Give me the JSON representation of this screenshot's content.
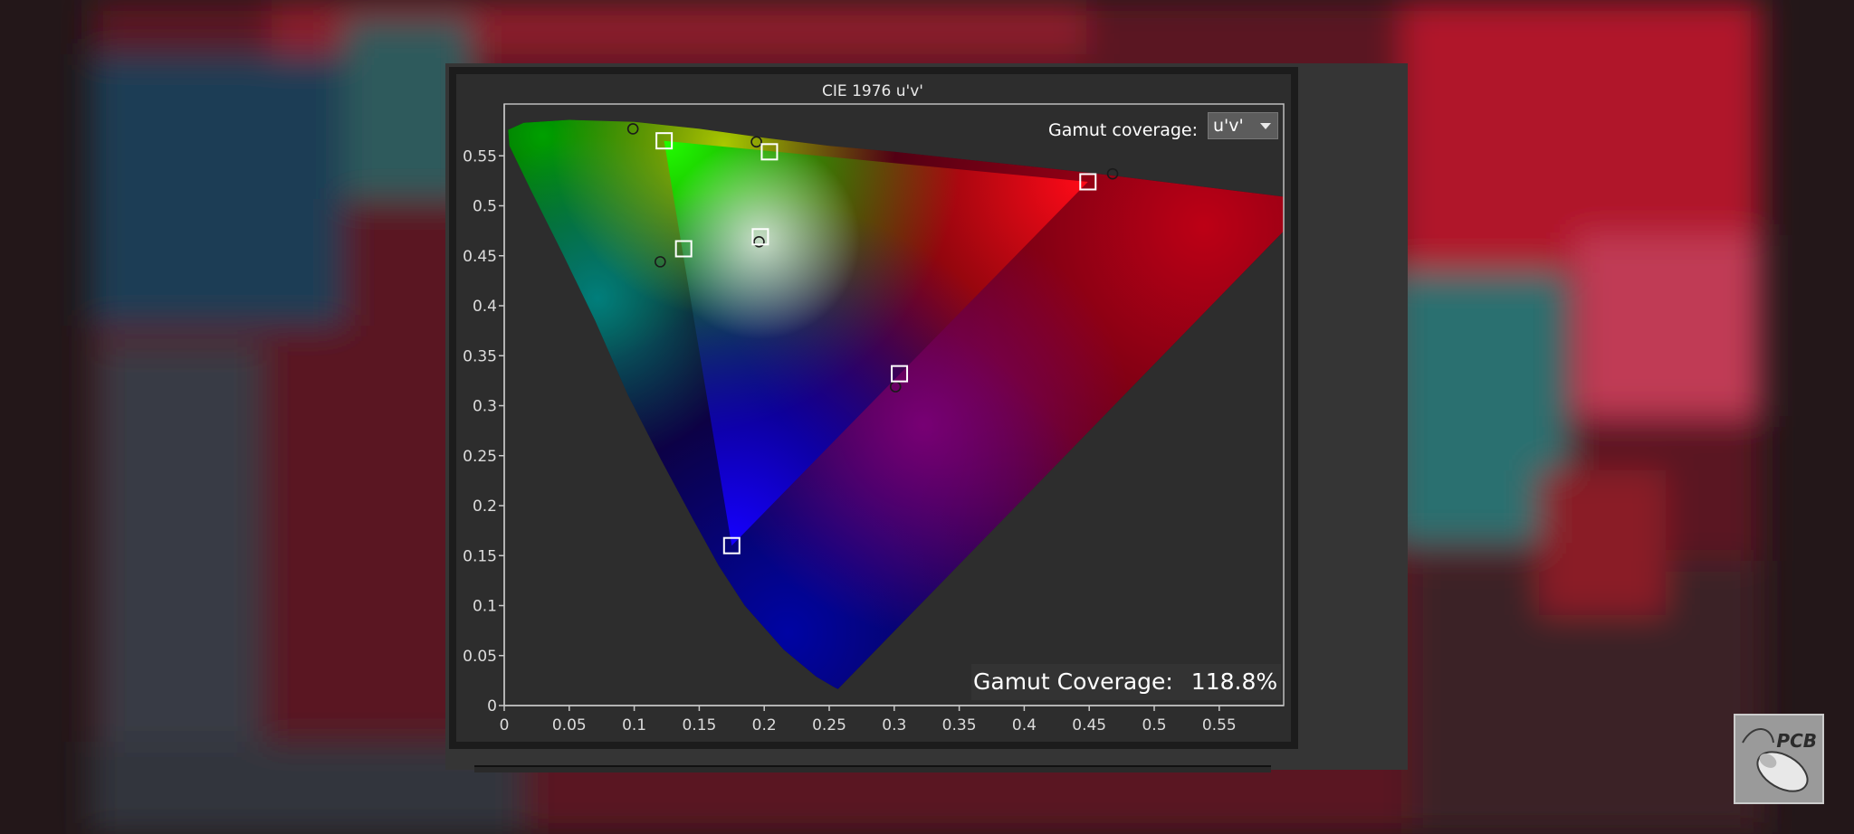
{
  "chart_data": {
    "type": "scatter",
    "title": "CIE 1976 u'v'",
    "xlim": [
      0,
      0.6
    ],
    "ylim": [
      0,
      0.6
    ],
    "x_ticks": [
      "0",
      "0.05",
      "0.1",
      "0.15",
      "0.2",
      "0.25",
      "0.3",
      "0.35",
      "0.4",
      "0.45",
      "0.5",
      "0.55"
    ],
    "y_ticks": [
      "0",
      "0.05",
      "0.1",
      "0.15",
      "0.2",
      "0.25",
      "0.3",
      "0.35",
      "0.4",
      "0.45",
      "0.5",
      "0.55"
    ],
    "grid": false,
    "measured_points": [
      {
        "u": 0.123,
        "v": 0.565
      },
      {
        "u": 0.204,
        "v": 0.554
      },
      {
        "u": 0.449,
        "v": 0.524
      },
      {
        "u": 0.138,
        "v": 0.457
      },
      {
        "u": 0.197,
        "v": 0.469
      },
      {
        "u": 0.304,
        "v": 0.332
      },
      {
        "u": 0.175,
        "v": 0.16
      }
    ],
    "target_points": [
      {
        "u": 0.099,
        "v": 0.577
      },
      {
        "u": 0.194,
        "v": 0.564
      },
      {
        "u": 0.468,
        "v": 0.532
      },
      {
        "u": 0.12,
        "v": 0.444
      },
      {
        "u": 0.196,
        "v": 0.464
      },
      {
        "u": 0.301,
        "v": 0.319
      }
    ],
    "gamut_triangle": [
      {
        "u": 0.123,
        "v": 0.565
      },
      {
        "u": 0.449,
        "v": 0.524
      },
      {
        "u": 0.175,
        "v": 0.16
      }
    ],
    "colors": {
      "background": "#2d2d2d",
      "axis": "#c8c8c8",
      "marker": "#ffffff"
    }
  },
  "ui": {
    "gamut_label": "Gamut coverage:",
    "gamut_mode": "u'v'",
    "coverage_label": "Gamut Coverage:",
    "coverage_value": "118.8%"
  },
  "icons": {
    "logo": "pcb-mouse-logo-icon",
    "dropdown": "dropdown-arrow-icon"
  },
  "logo_text": "PCB"
}
